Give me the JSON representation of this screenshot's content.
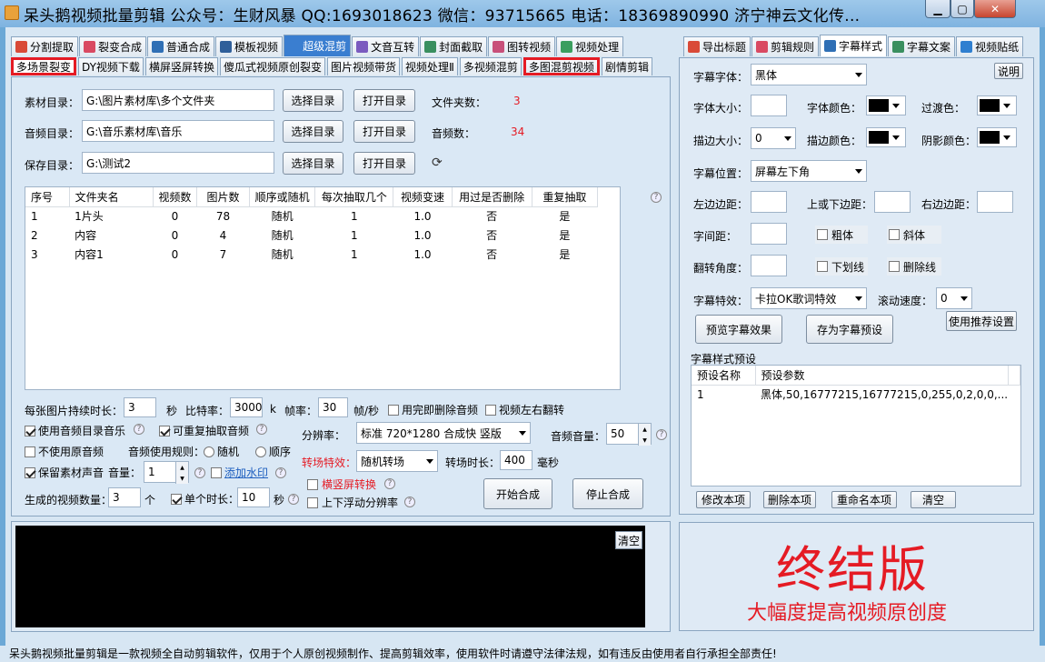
{
  "window": {
    "title": "呆头鹅视频批量剪辑 公众号：生财风暴 QQ:1693018623 微信：93715665 电话：18369890990 济宁神云文化传..."
  },
  "main_tabs": [
    {
      "label": "分割提取",
      "color": "#d94a38"
    },
    {
      "label": "裂变合成",
      "color": "#d94a62"
    },
    {
      "label": "普通合成",
      "color": "#2f6fb5"
    },
    {
      "label": "模板视频",
      "color": "#2f5f9a"
    },
    {
      "label": "超级混剪",
      "color": "#3a7ed0"
    },
    {
      "label": "文音互转",
      "color": "#7b5bbf"
    },
    {
      "label": "封面截取",
      "color": "#3a8f5f"
    },
    {
      "label": "图转视频",
      "color": "#c8507a"
    },
    {
      "label": "视频处理",
      "color": "#3a9e5f"
    }
  ],
  "sub_tabs": [
    "多场景裂变",
    "DY视频下载",
    "横屏竖屏转换",
    "傻瓜式视频原创裂变",
    "图片视频带货",
    "视频处理Ⅱ",
    "多视频混剪",
    "多图混剪视频",
    "剧情剪辑"
  ],
  "form": {
    "material_dir_label": "素材目录：",
    "material_dir_value": "G:\\图片素材库\\多个文件夹",
    "audio_dir_label": "音频目录：",
    "audio_dir_value": "G:\\音乐素材库\\音乐",
    "save_dir_label": "保存目录：",
    "save_dir_value": "G:\\测试2",
    "choose_dir": "选择目录",
    "open_dir": "打开目录",
    "folder_count_label": "文件夹数：",
    "folder_count": "3",
    "audio_count_label": "音频数：",
    "audio_count": "34"
  },
  "table": {
    "headers": [
      "序号",
      "文件夹名",
      "视频数",
      "图片数",
      "顺序或随机",
      "每次抽取几个",
      "视频变速",
      "用过是否删除",
      "重复抽取"
    ],
    "rows": [
      [
        "1",
        "1片头",
        "0",
        "78",
        "随机",
        "1",
        "1.0",
        "否",
        "是"
      ],
      [
        "2",
        "内容",
        "0",
        "4",
        "随机",
        "1",
        "1.0",
        "否",
        "是"
      ],
      [
        "3",
        "内容1",
        "0",
        "7",
        "随机",
        "1",
        "1.0",
        "否",
        "是"
      ]
    ]
  },
  "options": {
    "img_duration_label": "每张图片持续时长：",
    "img_duration": "3",
    "sec": "秒",
    "bitrate_label": "比特率：",
    "bitrate": "3000",
    "k": "k",
    "fps_label": "帧率：",
    "fps": "30",
    "fps_unit": "帧/秒",
    "delete_audio": "用完即删除音频",
    "flip_video": "视频左右翻转",
    "use_audio_music": "使用音频目录音乐",
    "repeat_audio": "可重复抽取音频",
    "no_original_audio": "不使用原音频",
    "audio_rule_label": "音频使用规则：",
    "random": "随机",
    "sequence": "顺序",
    "keep_sound": "保留素材声音",
    "volume_label": "音量：",
    "volume": "1",
    "watermark": "添加水印",
    "resolution_label": "分辨率：",
    "resolution": "标准 720*1280 合成快 竖版",
    "audio_volume_label": "音频音量：",
    "audio_volume": "50",
    "transition_label": "转场特效：",
    "transition": "随机转场",
    "transition_duration_label": "转场时长：",
    "transition_duration": "400",
    "ms": "毫秒",
    "landscape_convert": "横竖屏转换",
    "float_resolution": "上下浮动分辨率",
    "video_count_label": "生成的视频数量：",
    "video_count": "3",
    "count_unit": "个",
    "single_duration_label": "单个时长：",
    "single_duration": "10",
    "sec2": "秒",
    "start": "开始合成",
    "stop": "停止合成",
    "help": "?"
  },
  "console": {
    "clear": "清空"
  },
  "right_tabs": [
    {
      "label": "导出标题",
      "color": "#d94a38"
    },
    {
      "label": "剪辑规则",
      "color": "#d94a62"
    },
    {
      "label": "字幕样式",
      "color": "#2f6fb5"
    },
    {
      "label": "字幕文案",
      "color": "#3a8f5f"
    },
    {
      "label": "视频贴纸",
      "color": "#2f7fd0"
    }
  ],
  "subtitle": {
    "explain": "说明",
    "font_label": "字幕字体：",
    "font_value": "黑体",
    "size_label": "字体大小：",
    "size_value": "",
    "font_color_label": "字体颜色：",
    "transition_color_label": "过渡色：",
    "stroke_size_label": "描边大小：",
    "stroke_size_value": "0",
    "stroke_color_label": "描边颜色：",
    "shadow_color_label": "阴影颜色：",
    "position_label": "字幕位置：",
    "position_value": "屏幕左下角",
    "left_margin_label": "左边边距：",
    "top_margin_label": "上或下边距：",
    "right_margin_label": "右边边距：",
    "spacing_label": "字间距：",
    "bold": "粗体",
    "italic": "斜体",
    "rotate_label": "翻转角度：",
    "underline": "下划线",
    "strikeout": "删除线",
    "effect_label": "字幕特效：",
    "effect_value": "卡拉OK歌词特效",
    "scroll_label": "滚动速度：",
    "scroll_value": "0",
    "preview": "预览字幕效果",
    "save_preset": "存为字幕预设",
    "use_recommended": "使用推荐设置",
    "preset_section": "字幕样式预设",
    "preset_headers": [
      "预设名称",
      "预设参数"
    ],
    "preset_rows": [
      [
        "1",
        "黑体,50,16777215,16777215,0,255,0,2,0,0,..."
      ]
    ],
    "edit_item": "修改本项",
    "delete_item": "删除本项",
    "rename_item": "重命名本项",
    "clear": "清空",
    "swatch_color": "#000000"
  },
  "promo": {
    "title": "终结版",
    "subtitle": "大幅度提高视频原创度",
    "color": "#e51b24"
  },
  "status": "呆头鹅视频批量剪辑是一款视频全自动剪辑软件，仅用于个人原创视频制作、提高剪辑效率，使用软件时请遵守法律法规，如有违反由使用者自行承担全部责任!"
}
